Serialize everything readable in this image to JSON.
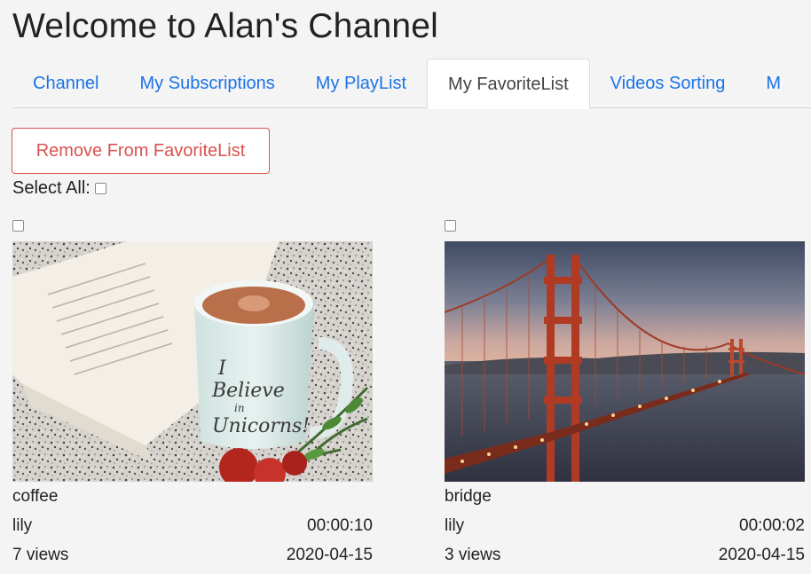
{
  "header": {
    "title": "Welcome to Alan's Channel"
  },
  "tabs": [
    {
      "label": "Channel",
      "active": false
    },
    {
      "label": "My Subscriptions",
      "active": false
    },
    {
      "label": "My PlayList",
      "active": false
    },
    {
      "label": "My FavoriteList",
      "active": true
    },
    {
      "label": "Videos Sorting",
      "active": false
    },
    {
      "label": "M",
      "active": false
    }
  ],
  "toolbar": {
    "remove_label": "Remove From FavoriteList",
    "select_all_label": "Select All:"
  },
  "videos": [
    {
      "title": "coffee",
      "author": "lily",
      "duration": "00:00:10",
      "views": "7 views",
      "date": "2020-04-15"
    },
    {
      "title": "bridge",
      "author": "lily",
      "duration": "00:00:02",
      "views": "3 views",
      "date": "2020-04-15"
    }
  ],
  "colors": {
    "link": "#1a73e8",
    "danger": "#d9534f",
    "background": "#f4f4f4"
  }
}
